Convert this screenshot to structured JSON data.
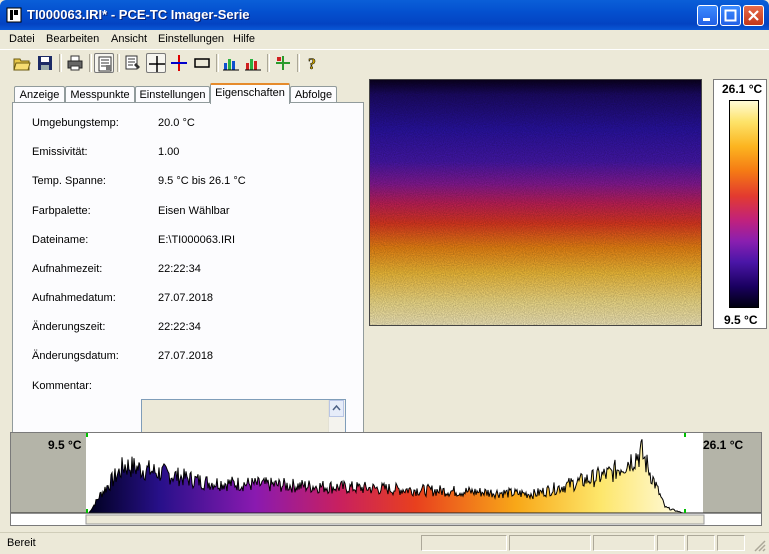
{
  "window": {
    "title": "TI000063.IRI* - PCE-TC Imager-Serie"
  },
  "menu": [
    "Datei",
    "Bearbeiten",
    "Ansicht",
    "Einstellungen",
    "Hilfe"
  ],
  "toolbar_icons": [
    "open-folder-icon",
    "save-disk-icon",
    "print-icon",
    "properties-icon",
    "edit-list-icon",
    "crosshair-icon",
    "color-crosshair-icon",
    "rectangle-icon",
    "chart-blue-icon",
    "chart-red-icon",
    "crosshair-plus-icon",
    "help-icon"
  ],
  "tabs": [
    "Anzeige",
    "Messpunkte",
    "Einstellungen",
    "Eigenschaften",
    "Abfolge"
  ],
  "active_tab": "Eigenschaften",
  "properties": [
    {
      "label": "Umgebungstemp:",
      "value": "20.0 °C"
    },
    {
      "label": "Emissivität:",
      "value": "1.00"
    },
    {
      "label": "Temp. Spanne:",
      "value": "9.5 °C bis 26.1 °C"
    },
    {
      "label": "Farbpalette:",
      "value": "Eisen Wählbar"
    },
    {
      "label": "Dateiname:",
      "value": "E:\\TI000063.IRI"
    },
    {
      "label": "Aufnahmezeit:",
      "value": "22:22:34"
    },
    {
      "label": "Aufnahmedatum:",
      "value": "27.07.2018"
    },
    {
      "label": "Änderungszeit:",
      "value": "22:22:34"
    },
    {
      "label": "Änderungsdatum:",
      "value": "27.07.2018"
    }
  ],
  "comment": {
    "label": "Kommentar:",
    "value": ""
  },
  "scale": {
    "max": "26.1 °C",
    "min": "9.5 °C"
  },
  "histogram": {
    "min_label": "9.5 °C",
    "max_label": "26.1 °C"
  },
  "status": {
    "text": "Bereit"
  },
  "colors": {
    "title_bar": "#0450cf",
    "window_bg": "#ece9d8",
    "active_tab_accent": "#e68b2c"
  }
}
